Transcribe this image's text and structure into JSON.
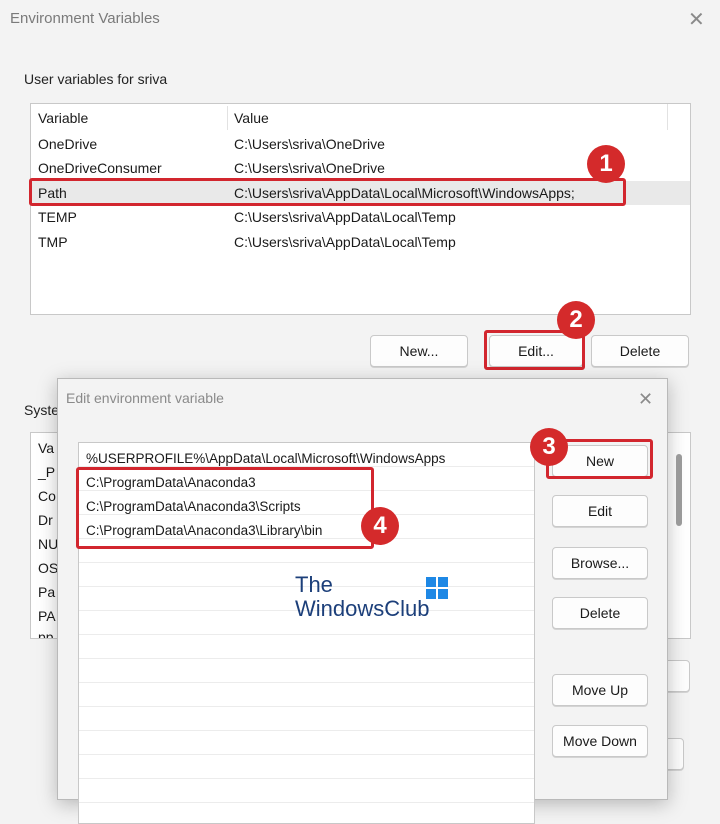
{
  "window": {
    "title": "Environment Variables",
    "close": "✕"
  },
  "user_vars": {
    "group_label": "User variables for sriva",
    "columns": [
      "Variable",
      "Value"
    ],
    "rows": [
      {
        "name": "OneDrive",
        "value": "C:\\Users\\sriva\\OneDrive"
      },
      {
        "name": "OneDriveConsumer",
        "value": "C:\\Users\\sriva\\OneDrive"
      },
      {
        "name": "Path",
        "value": "C:\\Users\\sriva\\AppData\\Local\\Microsoft\\WindowsApps;"
      },
      {
        "name": "TEMP",
        "value": "C:\\Users\\sriva\\AppData\\Local\\Temp"
      },
      {
        "name": "TMP",
        "value": "C:\\Users\\sriva\\AppData\\Local\\Temp"
      }
    ],
    "buttons": {
      "new": "New...",
      "edit": "Edit...",
      "delete": "Delete"
    }
  },
  "system_vars": {
    "group_label": "Syste",
    "rows_partial": [
      "Va",
      "_P",
      "Co",
      "Dr",
      "NU",
      "OS",
      "Pa",
      "PA",
      "pp"
    ]
  },
  "edit_dialog": {
    "title": "Edit environment variable",
    "close": "✕",
    "entries": [
      "%USERPROFILE%\\AppData\\Local\\Microsoft\\WindowsApps",
      "C:\\ProgramData\\Anaconda3",
      "C:\\ProgramData\\Anaconda3\\Scripts",
      "C:\\ProgramData\\Anaconda3\\Library\\bin"
    ],
    "buttons": {
      "new": "New",
      "edit": "Edit",
      "browse": "Browse...",
      "delete": "Delete",
      "move_up": "Move Up",
      "move_down": "Move Down"
    }
  },
  "watermark": {
    "line1": "The",
    "line2": "WindowsClub"
  },
  "annotations": {
    "step1": "1",
    "step2": "2",
    "step3": "3",
    "step4": "4"
  },
  "colors": {
    "highlight": "#d2262e",
    "background": "#f3f3f3",
    "watermark_text": "#1c3f7a"
  }
}
